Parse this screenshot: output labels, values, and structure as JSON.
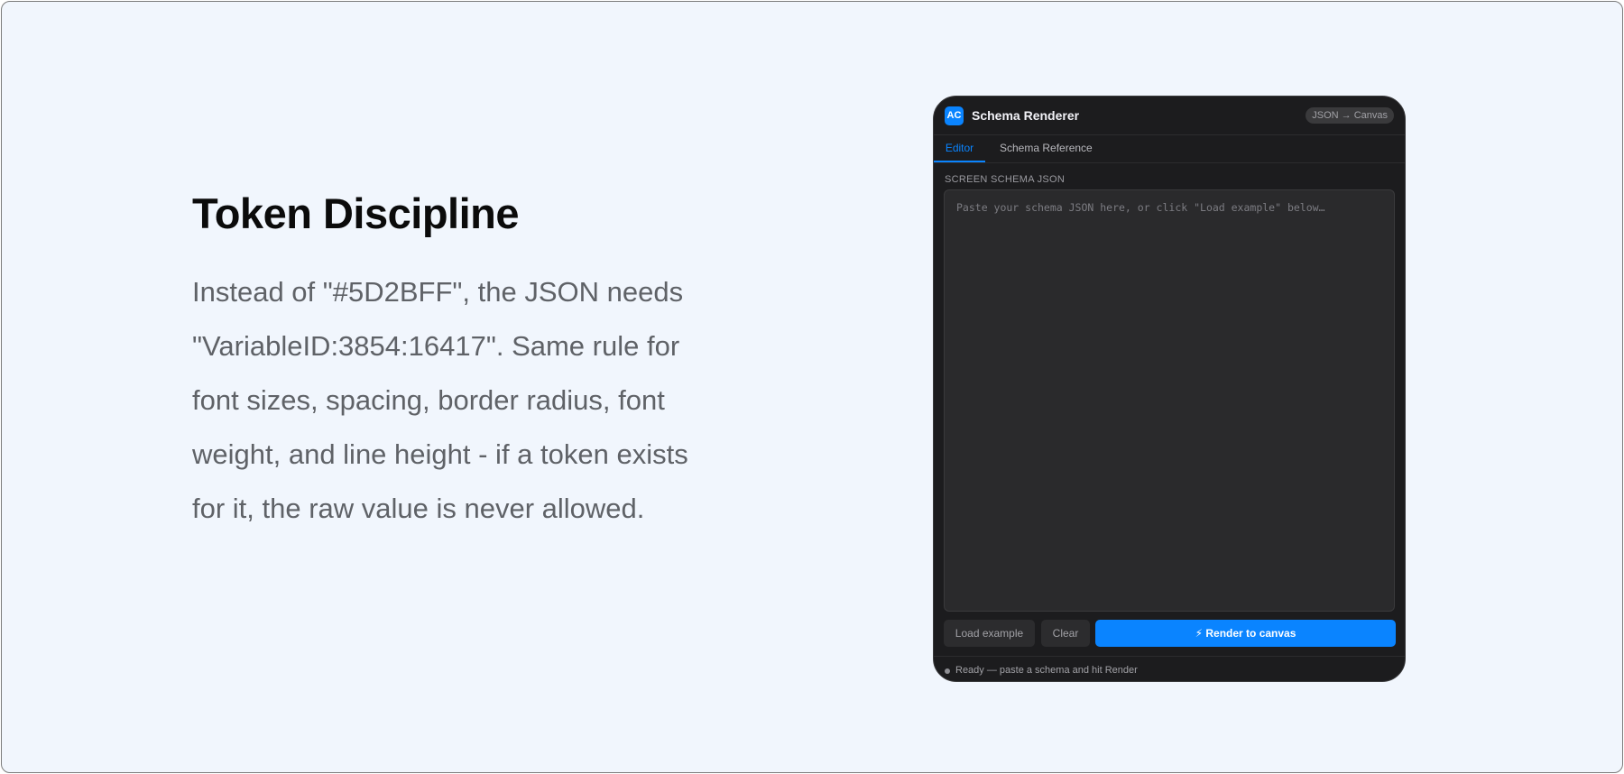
{
  "slide": {
    "title": "Token Discipline",
    "body": "Instead of \"#5D2BFF\", the JSON needs \"VariableID:3854:16417\". Same rule for font sizes, spacing, border radius, font weight, and line height - if a token exists for it, the raw value is never allowed."
  },
  "plugin": {
    "logo_text": "AC",
    "app_title": "Schema Renderer",
    "mode_label": "JSON → Canvas",
    "tabs": [
      {
        "label": "Editor",
        "active": true
      },
      {
        "label": "Schema Reference",
        "active": false
      }
    ],
    "section_label": "SCREEN SCHEMA JSON",
    "editor": {
      "value": "",
      "placeholder": "Paste your schema JSON here, or click \"Load example\" below…"
    },
    "buttons": {
      "load_example": "Load example",
      "clear": "Clear",
      "render": "⚡ Render to canvas"
    },
    "status": {
      "text": "Ready — paste a schema and hit Render"
    }
  },
  "colors": {
    "page_background": "#f1f6fd",
    "accent": "#0a84ff",
    "window_background": "#1c1c1e"
  }
}
